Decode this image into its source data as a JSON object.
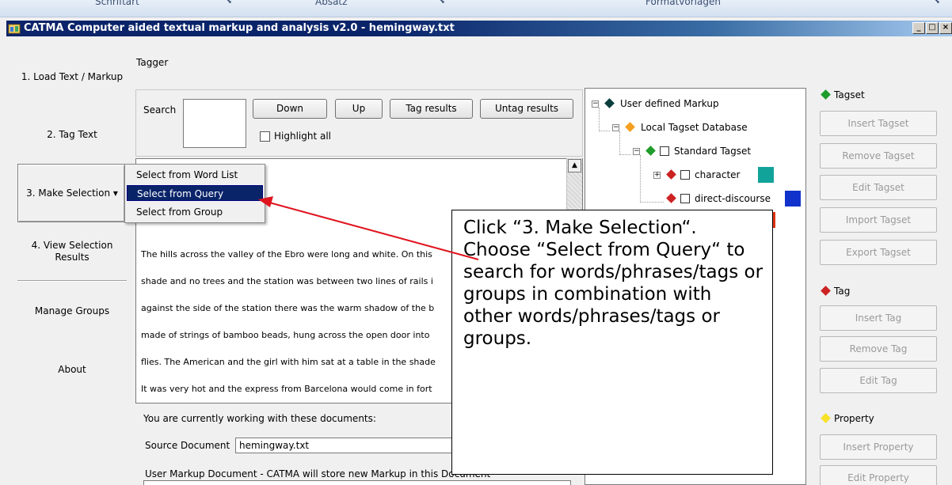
{
  "ribbon": {
    "labels": [
      "Schriftart",
      "Absatz",
      "Formatvorlagen"
    ]
  },
  "window": {
    "title": "CATMA Computer aided textual markup and analysis v2.0  - hemingway.txt",
    "minimize": "_",
    "maximize": "□",
    "close": "×"
  },
  "nav": {
    "load": "1. Load Text / Markup",
    "tag": "2. Tag Text",
    "selection": "3. Make Selection ▾",
    "view_line1": "4. View Selection",
    "view_line2": "Results",
    "groups": "Manage Groups",
    "about": "About"
  },
  "tagger": {
    "title": "Tagger",
    "search_label": "Search",
    "search_value": "",
    "down": "Down",
    "up": "Up",
    "tag_results": "Tag results",
    "untag_results": "Untag results",
    "highlight_all": "Highlight all"
  },
  "menu": {
    "items": [
      "Select from Word List",
      "Select from Query",
      "Select from Group"
    ]
  },
  "text": {
    "lines": [
      "The hills across the valley of the Ebro were long and white. On this",
      "shade and no trees and the station was between two lines of rails i",
      "against the side of the station there was the warm shadow of the b",
      "made of strings of bamboo beads, hung across the open door into",
      "flies. The American and the girl with him sat at a table in the shade",
      "It was very hot and the express from Barcelona would come in fort"
    ]
  },
  "documents": {
    "intro": "You are currently working with these documents:",
    "source_label": "Source Document",
    "source_value": "hemingway.txt",
    "user_markup_label": "User Markup Document - CATMA will store new Markup in this Document"
  },
  "tree": {
    "root": "User defined Markup",
    "db": "Local Tagset Database",
    "tagset": "Standard Tagset",
    "tag1": "character",
    "tag2": "direct-discourse",
    "colors": {
      "root": "#0b3d3d",
      "db": "#f5a020",
      "tagset": "#1f9c2a",
      "tag": "#cc2222",
      "character": "#11a39a",
      "direct_discourse": "#1133cc",
      "partial": "#dd3311"
    }
  },
  "right": {
    "tagset_head": "Tagset",
    "insert_tagset": "Insert Tagset",
    "remove_tagset": "Remove Tagset",
    "edit_tagset": "Edit Tagset",
    "import_tagset": "Import Tagset",
    "export_tagset": "Export Tagset",
    "tag_head": "Tag",
    "insert_tag": "Insert Tag",
    "remove_tag": "Remove Tag",
    "edit_tag": "Edit Tag",
    "property_head": "Property",
    "insert_property": "Insert Property",
    "edit_property": "Edit Property"
  },
  "callout": {
    "text": "Click “3. Make Selection“. Choose “Select from Query“ to search for words/phrases/tags or groups in combination with other words/phrases/tags or groups.",
    "arrow_color": "#e0141e"
  }
}
